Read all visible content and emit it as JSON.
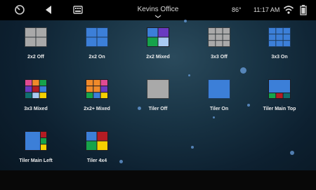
{
  "status_bar": {
    "title": "Kevins Office",
    "temperature": "86°",
    "time": "11:17 AM",
    "icons": [
      "gauge-icon",
      "back-arrow-icon",
      "keyboard-icon",
      "chevron-down-icon",
      "wifi-icon",
      "battery-icon"
    ]
  },
  "presets": [
    {
      "label": "2x2 Off"
    },
    {
      "label": "2x2 On"
    },
    {
      "label": "2x2 Mixed"
    },
    {
      "label": "3x3 Off"
    },
    {
      "label": "3x3 On"
    },
    {
      "label": "3x3 Mixed"
    },
    {
      "label": "2x2+ Mixed"
    },
    {
      "label": "Tiler Off"
    },
    {
      "label": "Tiler On"
    },
    {
      "label": "Tiler Main Top"
    },
    {
      "label": "Tiler Main Left"
    },
    {
      "label": "Tiler 4x4"
    }
  ],
  "colors": {
    "off_gray": "#a9a9a9",
    "on_blue": "#3c7fd8",
    "red": "#b41c23",
    "green": "#16a34a",
    "purple": "#6a3ac0",
    "light_blue": "#a9c9f1",
    "yellow": "#f5d000",
    "orange": "#f08a2a",
    "pink": "#e24a92",
    "dark_teal": "#0f6e6e"
  }
}
